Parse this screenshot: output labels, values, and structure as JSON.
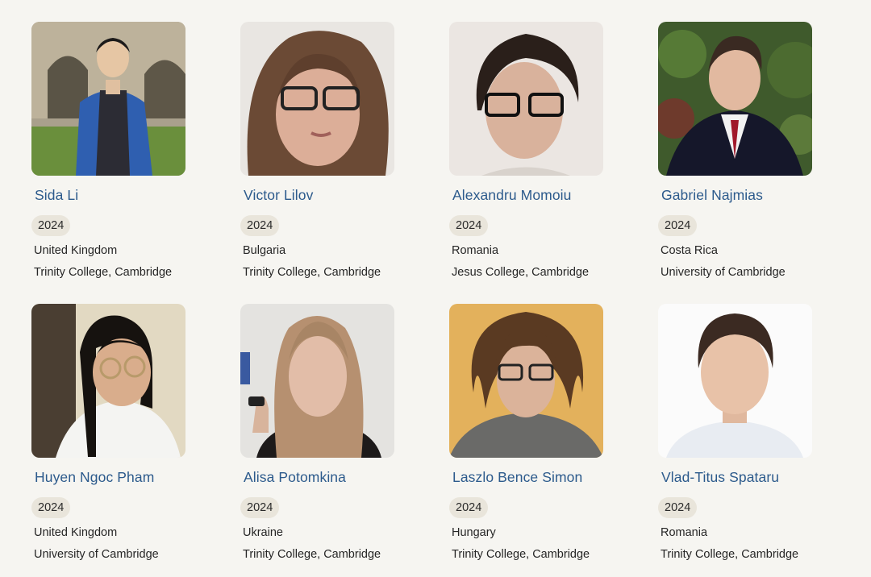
{
  "people": [
    {
      "name": "Sida Li",
      "year": "2024",
      "country": "United Kingdom",
      "college": "Trinity College, Cambridge",
      "photo": "portrait-photo"
    },
    {
      "name": "Victor Lilov",
      "year": "2024",
      "country": "Bulgaria",
      "college": "Trinity College, Cambridge",
      "photo": "portrait-photo"
    },
    {
      "name": "Alexandru Momoiu",
      "year": "2024",
      "country": "Romania",
      "college": "Jesus College, Cambridge",
      "photo": "portrait-photo"
    },
    {
      "name": "Gabriel Najmias",
      "year": "2024",
      "country": "Costa Rica",
      "college": "University of Cambridge",
      "photo": "portrait-photo"
    },
    {
      "name": "Huyen Ngoc Pham",
      "year": "2024",
      "country": "United Kingdom",
      "college": "University of Cambridge",
      "photo": "portrait-photo"
    },
    {
      "name": "Alisa Potomkina",
      "year": "2024",
      "country": "Ukraine",
      "college": "Trinity College, Cambridge",
      "photo": "portrait-photo"
    },
    {
      "name": "Laszlo Bence Simon",
      "year": "2024",
      "country": "Hungary",
      "college": "Trinity College, Cambridge",
      "photo": "portrait-photo"
    },
    {
      "name": "Vlad-Titus Spataru",
      "year": "2024",
      "country": "Romania",
      "college": "Trinity College, Cambridge",
      "photo": "portrait-photo"
    }
  ],
  "colors": {
    "background": "#f6f5f1",
    "name_link": "#2c5a8c",
    "year_badge": "#e9e5db"
  }
}
